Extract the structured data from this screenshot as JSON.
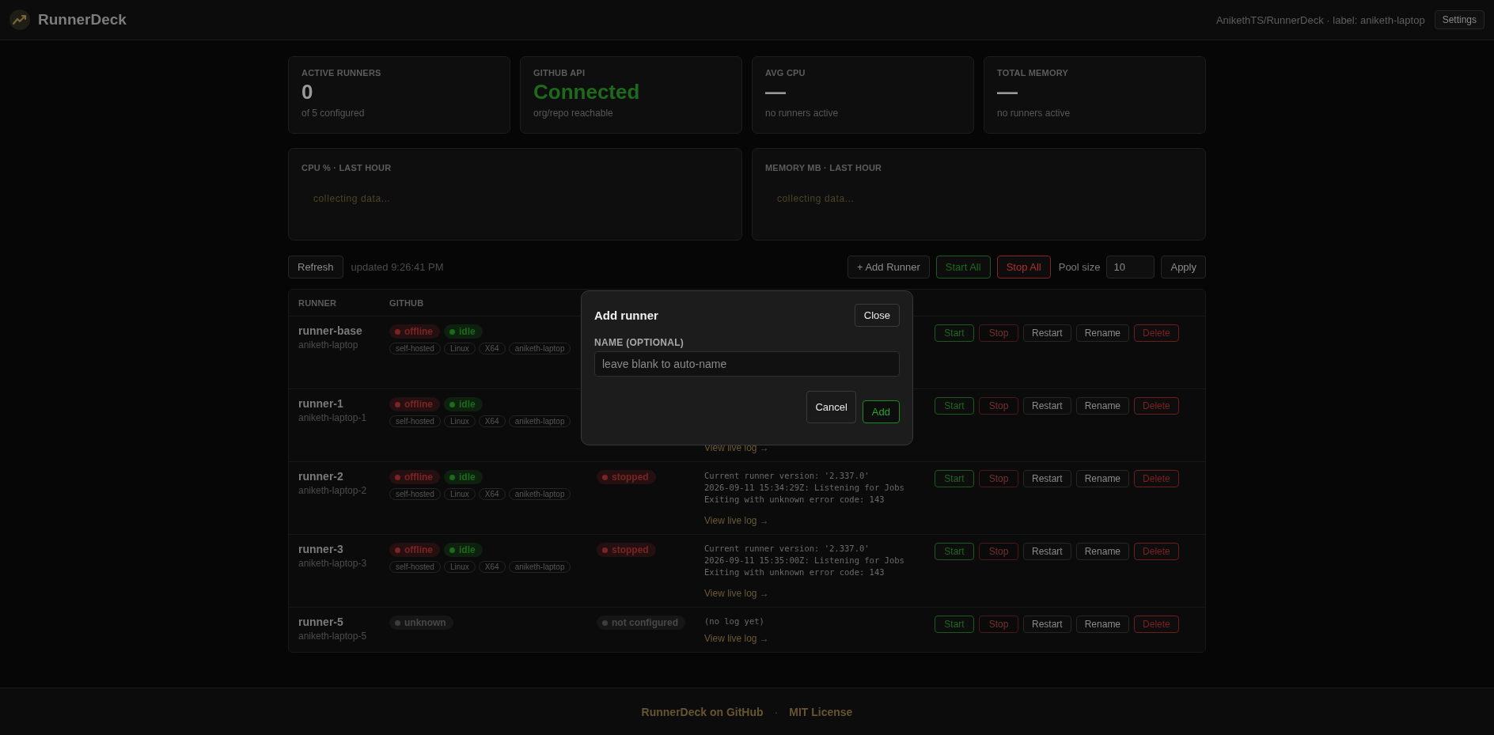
{
  "header": {
    "brand": "RunnerDeck",
    "repo": "AnikethTS/RunnerDeck · label: aniketh-laptop",
    "settings": "Settings"
  },
  "stats": [
    {
      "label": "ACTIVE RUNNERS",
      "value": "0",
      "kind": "number",
      "sub": "of 5 configured"
    },
    {
      "label": "GITHUB API",
      "value": "Connected",
      "kind": "ok",
      "sub": "org/repo reachable"
    },
    {
      "label": "AVG CPU",
      "value": "—",
      "kind": "number",
      "sub": "no runners active"
    },
    {
      "label": "TOTAL MEMORY",
      "value": "—",
      "kind": "number",
      "sub": "no runners active"
    }
  ],
  "charts": [
    {
      "title": "CPU % · LAST HOUR",
      "empty": "collecting data..."
    },
    {
      "title": "MEMORY MB · LAST HOUR",
      "empty": "collecting data..."
    }
  ],
  "toolbar": {
    "refresh": "Refresh",
    "updated": "updated 9:26:41 PM",
    "add": "+ Add Runner",
    "start_all": "Start All",
    "stop_all": "Stop All",
    "pool_label": "Pool size",
    "pool_value": "10",
    "apply": "Apply"
  },
  "table": {
    "columns": [
      "RUNNER",
      "GITHUB"
    ],
    "rows": [
      {
        "name": "runner-base",
        "host": "aniketh-laptop",
        "badges": [
          {
            "kind": "red",
            "text": "offline"
          },
          {
            "kind": "green",
            "text": "idle"
          }
        ],
        "tags": [
          "self-hosted",
          "Linux",
          "X64",
          "aniketh-laptop"
        ],
        "actions": [
          {
            "kind": "start",
            "label": "Start",
            "disabled": false
          },
          {
            "kind": "stop",
            "label": "Stop",
            "disabled": true
          },
          {
            "kind": "plain",
            "label": "Restart",
            "disabled": false
          },
          {
            "kind": "plain",
            "label": "Rename",
            "disabled": false
          },
          {
            "kind": "danger",
            "label": "Delete",
            "disabled": false
          }
        ]
      },
      {
        "name": "runner-1",
        "host": "aniketh-laptop-1",
        "badges": [
          {
            "kind": "red",
            "text": "offline"
          },
          {
            "kind": "green",
            "text": "idle"
          }
        ],
        "tags": [
          "self-hosted",
          "Linux",
          "X64",
          "aniketh-laptop"
        ],
        "log": {
          "link": "View live log →"
        },
        "actions": [
          {
            "kind": "start",
            "label": "Start",
            "disabled": false
          },
          {
            "kind": "stop",
            "label": "Stop",
            "disabled": true
          },
          {
            "kind": "plain",
            "label": "Restart",
            "disabled": false
          },
          {
            "kind": "plain",
            "label": "Rename",
            "disabled": false
          },
          {
            "kind": "danger",
            "label": "Delete",
            "disabled": false
          }
        ]
      },
      {
        "name": "runner-2",
        "host": "aniketh-laptop-2",
        "badges": [
          {
            "kind": "red",
            "text": "offline"
          },
          {
            "kind": "green",
            "text": "idle"
          }
        ],
        "tags": [
          "self-hosted",
          "Linux",
          "X64",
          "aniketh-laptop"
        ],
        "status": {
          "kind": "red",
          "text": "stopped"
        },
        "log": {
          "lines": [
            "Current runner version: '2.337.0'",
            "2026-09-11 15:34:29Z: Listening for Jobs",
            "Exiting with unknown error code: 143"
          ],
          "link": "View live log →"
        },
        "actions": [
          {
            "kind": "start",
            "label": "Start",
            "disabled": false
          },
          {
            "kind": "stop",
            "label": "Stop",
            "disabled": true
          },
          {
            "kind": "plain",
            "label": "Restart",
            "disabled": false
          },
          {
            "kind": "plain",
            "label": "Rename",
            "disabled": false
          },
          {
            "kind": "danger",
            "label": "Delete",
            "disabled": false
          }
        ]
      },
      {
        "name": "runner-3",
        "host": "aniketh-laptop-3",
        "badges": [
          {
            "kind": "red",
            "text": "offline"
          },
          {
            "kind": "green",
            "text": "idle"
          }
        ],
        "tags": [
          "self-hosted",
          "Linux",
          "X64",
          "aniketh-laptop"
        ],
        "status": {
          "kind": "red",
          "text": "stopped"
        },
        "log": {
          "lines": [
            "Current runner version: '2.337.0'",
            "2026-09-11 15:35:00Z: Listening for Jobs",
            "Exiting with unknown error code: 143"
          ],
          "link": "View live log →"
        },
        "actions": [
          {
            "kind": "start",
            "label": "Start",
            "disabled": false
          },
          {
            "kind": "stop",
            "label": "Stop",
            "disabled": true
          },
          {
            "kind": "plain",
            "label": "Restart",
            "disabled": false
          },
          {
            "kind": "plain",
            "label": "Rename",
            "disabled": false
          },
          {
            "kind": "danger",
            "label": "Delete",
            "disabled": false
          }
        ]
      },
      {
        "name": "runner-5",
        "host": "aniketh-laptop-5",
        "badges": [
          {
            "kind": "grey",
            "text": "unknown"
          }
        ],
        "tags": [],
        "status": {
          "kind": "grey",
          "text": "not configured"
        },
        "log": {
          "lines": [
            "(no log yet)"
          ],
          "link": "View live log →"
        },
        "actions": [
          {
            "kind": "start",
            "label": "Start",
            "disabled": false
          },
          {
            "kind": "stop",
            "label": "Stop",
            "disabled": true
          },
          {
            "kind": "plain",
            "label": "Restart",
            "disabled": false
          },
          {
            "kind": "plain",
            "label": "Rename",
            "disabled": false
          },
          {
            "kind": "danger",
            "label": "Delete",
            "disabled": false
          }
        ]
      }
    ]
  },
  "modal": {
    "title": "Add runner",
    "close": "Close",
    "field_label": "NAME (OPTIONAL)",
    "placeholder": "leave blank to auto-name",
    "cancel": "Cancel",
    "add": "Add"
  },
  "footer": {
    "links": [
      "RunnerDeck on GitHub",
      "MIT License"
    ],
    "separator": "·"
  }
}
